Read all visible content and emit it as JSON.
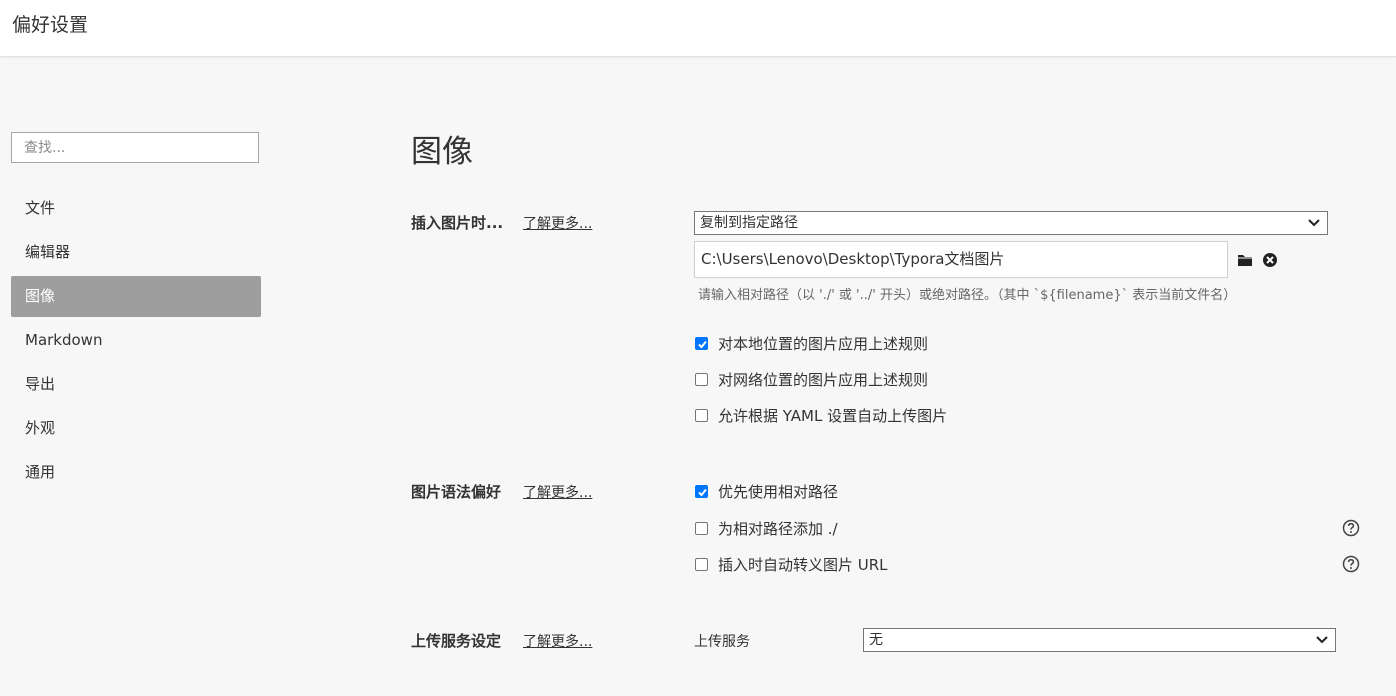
{
  "window": {
    "title": "偏好设置"
  },
  "sidebar": {
    "search_placeholder": "查找...",
    "items": [
      {
        "label": "文件"
      },
      {
        "label": "编辑器"
      },
      {
        "label": "图像"
      },
      {
        "label": "Markdown"
      },
      {
        "label": "导出"
      },
      {
        "label": "外观"
      },
      {
        "label": "通用"
      }
    ],
    "active_index": 2
  },
  "main": {
    "title": "图像",
    "insert": {
      "label": "插入图片时...",
      "learn_more": "了解更多...",
      "select_value": "复制到指定路径",
      "path_value": "C:\\Users\\Lenovo\\Desktop\\Typora文档图片",
      "hint": "请输入相对路径（以 './' 或 '../' 开头）或绝对路径。（其中 `${filename}` 表示当前文件名）",
      "options": [
        {
          "label": "对本地位置的图片应用上述规则",
          "checked": true
        },
        {
          "label": "对网络位置的图片应用上述规则",
          "checked": false
        },
        {
          "label": "允许根据 YAML 设置自动上传图片",
          "checked": false
        }
      ]
    },
    "syntax": {
      "label": "图片语法偏好",
      "learn_more": "了解更多...",
      "options": [
        {
          "label": "优先使用相对路径",
          "checked": true
        },
        {
          "label": "为相对路径添加 ./",
          "checked": false
        },
        {
          "label": "插入时自动转义图片 URL",
          "checked": false
        }
      ]
    },
    "upload": {
      "label": "上传服务设定",
      "learn_more": "了解更多...",
      "service_label": "上传服务",
      "service_value": "无"
    }
  },
  "colors": {
    "active_nav_bg": "#9e9e9e",
    "checkbox_accent": "#0075ff",
    "page_bg": "#f7f7f7"
  },
  "icons": [
    "folder-icon",
    "clear-icon",
    "help-icon",
    "chevron-down-icon",
    "checkmark-icon"
  ]
}
